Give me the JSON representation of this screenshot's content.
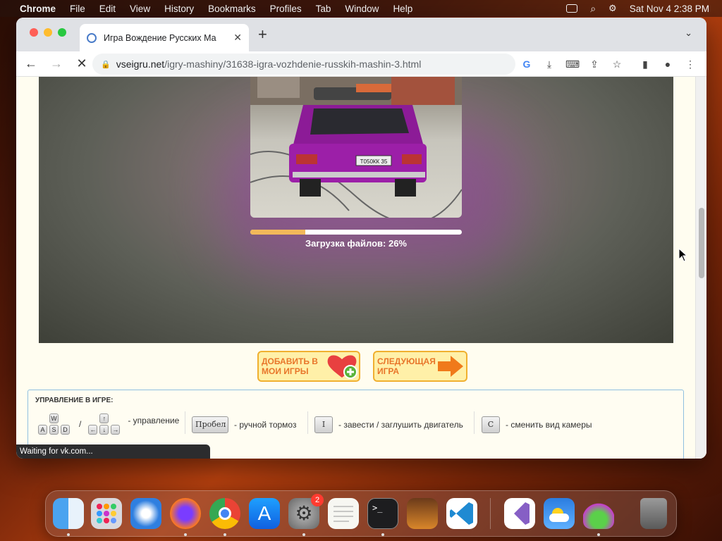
{
  "menubar": {
    "app_name": "Chrome",
    "menus": [
      "File",
      "Edit",
      "View",
      "History",
      "Bookmarks",
      "Profiles",
      "Tab",
      "Window",
      "Help"
    ],
    "datetime": "Sat Nov 4  2:38 PM"
  },
  "browser": {
    "tab_title": "Игра Вождение Русских Ма",
    "url_host": "vseigru.net",
    "url_path": "/igry-mashiny/31638-igra-vozhdenie-russkih-mashin-3.html",
    "status_text": "Waiting for vk.com..."
  },
  "game": {
    "plate": "Т050КК 35",
    "progress_fraction": 0.26,
    "progress_text": "Загрузка файлов: 26%"
  },
  "buttons": {
    "add_label": "Добавить в мои игры",
    "next_label": "Следующая игра"
  },
  "controls": {
    "title": "УПРАВЛЕНИЕ В ИГРЕ:",
    "keys_wasd": [
      "W",
      "A",
      "S",
      "D"
    ],
    "slash": "/",
    "keys_arrows": [
      "↑",
      "←",
      "↓",
      "→"
    ],
    "steer_text": "- управление",
    "space_key": "Пробел",
    "brake_text": "- ручной тормоз",
    "engine_key": "I",
    "engine_text": "- завести / заглушить двигатель",
    "camera_key": "C",
    "camera_text": "- сменить вид камеры"
  },
  "dock": {
    "settings_badge": "2",
    "apps": [
      "finder",
      "launchpad",
      "safari",
      "firefox",
      "chrome",
      "app-store",
      "system-settings",
      "textedit",
      "terminal",
      "garageband",
      "vscode",
      "visual-studio",
      "weather",
      "rosetta",
      "trash"
    ]
  },
  "colors": {
    "accent_orange": "#e8762a",
    "progress": "#f2b85a",
    "car_purple": "#9c1fa8"
  }
}
